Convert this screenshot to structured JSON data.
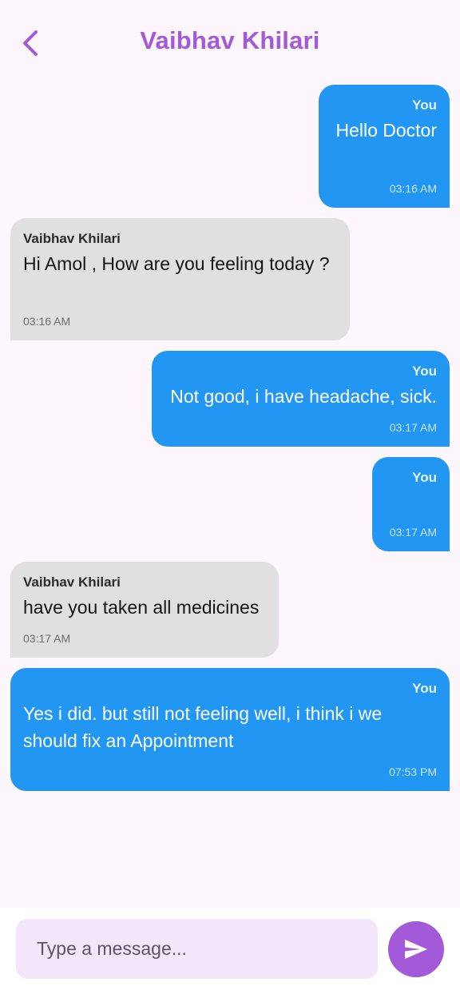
{
  "header": {
    "title": "Vaibhav Khilari",
    "back_icon": "chevron-left-icon",
    "accent_color": "#a35ad8"
  },
  "messages": [
    {
      "sender": "You",
      "text": "Hello Doctor",
      "time": "03:16 AM",
      "from_me": true
    },
    {
      "sender": "Vaibhav Khilari",
      "text": "Hi Amol , How are you feeling today ?",
      "time": "03:16 AM",
      "from_me": false
    },
    {
      "sender": "You",
      "text": "Not good, i have headache, sick.",
      "time": "03:17 AM",
      "from_me": true
    },
    {
      "sender": "You",
      "text": "",
      "time": "03:17 AM",
      "from_me": true
    },
    {
      "sender": "Vaibhav Khilari",
      "text": "have you taken all medicines",
      "time": "03:17 AM",
      "from_me": false
    },
    {
      "sender": "You",
      "text": "Yes i did. but still not feeling well, i think i we should fix an Appointment",
      "time": "07:53 PM",
      "from_me": true
    }
  ],
  "composer": {
    "placeholder": "Type a message...",
    "value": "",
    "send_icon": "send-icon"
  },
  "colors": {
    "my_bubble": "#2196f3",
    "their_bubble": "#e0e0e0",
    "background": "#fdf6fc"
  }
}
